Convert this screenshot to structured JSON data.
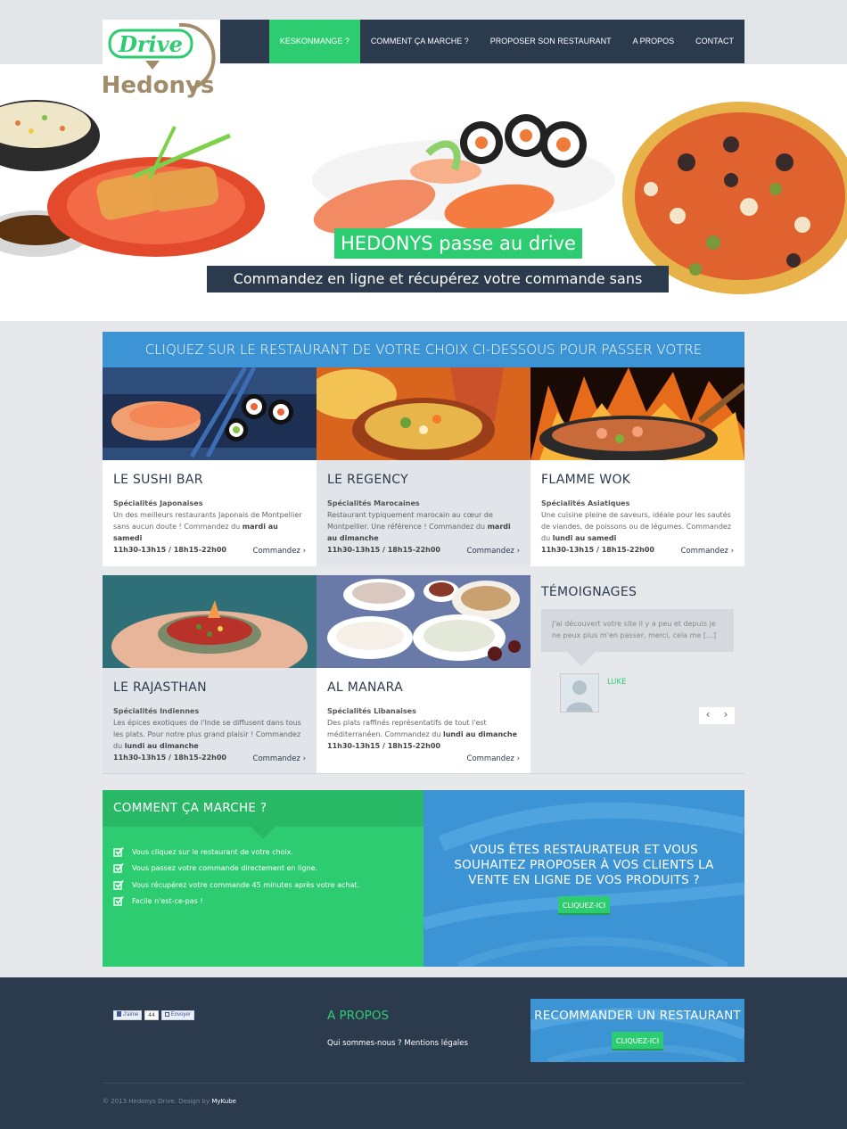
{
  "header": {
    "logo_text_top": "Drive",
    "logo_text_bottom": "Hedonys",
    "nav": [
      {
        "label": "KESKONMANGE ?",
        "active": true
      },
      {
        "label": "COMMENT ÇA MARCHE ?",
        "active": false
      },
      {
        "label": "PROPOSER SON RESTAURANT",
        "active": false
      },
      {
        "label": "A PROPOS",
        "active": false
      },
      {
        "label": "CONTACT",
        "active": false
      }
    ]
  },
  "hero": {
    "title": "HEDONYS passe au drive !",
    "subtitle": "Commandez en ligne et récupérez votre commande sans attendre…"
  },
  "restaurants": {
    "banner": "CLIQUEZ SUR LE RESTAURANT DE VOTRE CHOIX CI-DESSOUS POUR PASSER VOTRE COMMANDE.",
    "order_label": "Commandez ›",
    "items": [
      {
        "name": "LE SUSHI BAR",
        "specialty": "Spécialités Japonaises",
        "desc": "Un des meilleurs restaurants Japonais de Montpellier sans aucun doute ! Commandez du ",
        "days": "mardi au samedi",
        "hours": "11h30-13h15 / 18h15-22h00"
      },
      {
        "name": "LE REGENCY",
        "specialty": "Spécialités Marocaines",
        "desc": "Restaurant typiquement marocain au cœur de Montpellier. Une référence ! Commandez du ",
        "days": "mardi au dimanche",
        "hours": "11h30-13h15 / 18h15-22h00"
      },
      {
        "name": "FLAMME WOK",
        "specialty": "Spécialités Asiatiques",
        "desc": "Une cuisine pleine de saveurs, idéale pour les sautés de viandes, de poissons ou de légumes. Commandez du ",
        "days": "lundi au samedi",
        "hours": "11h30-13h15 / 18h15-22h00"
      },
      {
        "name": "LE RAJASTHAN",
        "specialty": "Spécialités Indiennes",
        "desc": "Les épices exotiques de l'Inde se diffusent dans tous les plats. Pour notre plus grand plaisir ! Commandez du ",
        "days": "lundi au dimanche",
        "hours": "11h30-13h15 / 18h15-22h00"
      },
      {
        "name": "AL MANARA",
        "specialty": "Spécialités Libanaises",
        "desc": "Des plats raffinés représentatifs de tout l'est méditerranéen. Commandez du ",
        "days": "lundi au dimanche",
        "hours": "11h30-13h15 / 18h15-22h00"
      }
    ]
  },
  "testimonials": {
    "title": "TÉMOIGNAGES",
    "quote": "J'ai découvert votre site il y a peu et depuis je ne peux plus m'en passer, merci, cela me […]",
    "author": "LUKE",
    "prev": "‹",
    "next": "›"
  },
  "how": {
    "title": "COMMENT ÇA MARCHE ?",
    "steps": [
      "Vous cliquez sur le restaurant de votre choix.",
      "Vous passez votre commande directement en ligne.",
      "Vous récupérez votre commande 45 minutes après votre achat.",
      "Facile n'est-ce-pas !"
    ]
  },
  "restaurateur": {
    "text": "VOUS ÊTES RESTAURATEUR ET VOUS SOUHAITEZ PROPOSER À VOS CLIENTS LA VENTE EN LIGNE DE VOS PRODUITS ?",
    "button": "CLIQUEZ-ICI"
  },
  "footer": {
    "fb_like": "J'aime",
    "fb_count": "44",
    "fb_send": "Envoyer",
    "about_title": "A PROPOS",
    "about_links": "Qui sommes-nous ? Mentions légales",
    "recommend_title": "RECOMMANDER UN RESTAURANT",
    "recommend_button": "CLIQUEZ-ICI",
    "copyright": "© 2013 Hedonys Drive. Design by ",
    "designer": "MyKube"
  },
  "colors": {
    "green": "#2ecc71",
    "navy": "#2c3a4e",
    "blue": "#3d94d4",
    "bg": "#e6e8eb"
  }
}
